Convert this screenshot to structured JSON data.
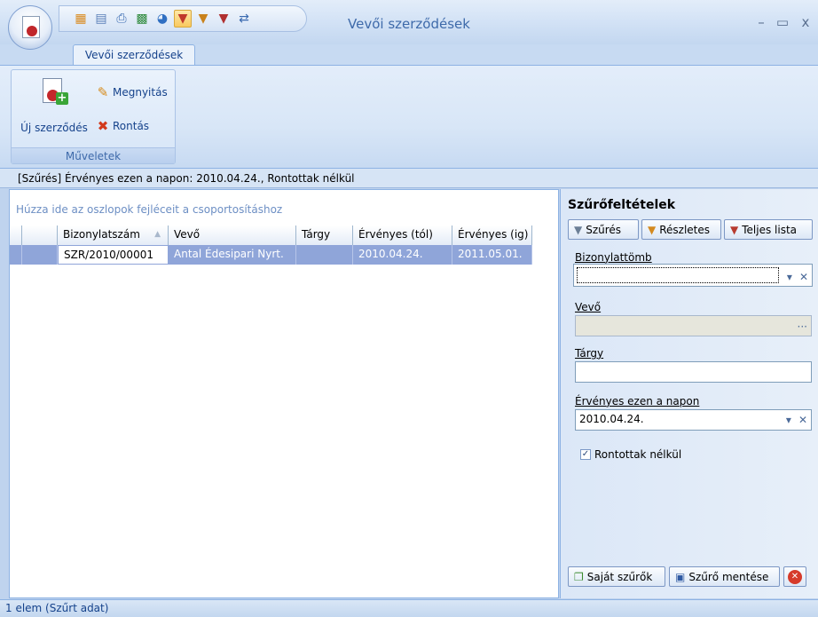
{
  "window": {
    "title": "Vevői szerződések",
    "controls": {
      "minimize": "–",
      "maximize": "▭",
      "close": "x"
    }
  },
  "quick_access": [
    {
      "name": "grid-icon",
      "glyph": "▦",
      "color": "#d98a1e"
    },
    {
      "name": "table-layout-icon",
      "glyph": "▤",
      "color": "#5a7fb8"
    },
    {
      "name": "print-icon",
      "glyph": "⎙",
      "color": "#3c6db3"
    },
    {
      "name": "excel-export-icon",
      "glyph": "▩",
      "color": "#2f8a3d"
    },
    {
      "name": "chart-icon",
      "glyph": "◕",
      "color": "#2f6fc2"
    },
    {
      "name": "filter-icon",
      "glyph": "▼",
      "color": "#c0392b",
      "active": true
    },
    {
      "name": "filter-detail-icon",
      "glyph": "▼",
      "color": "#c9821c"
    },
    {
      "name": "filter-remove-icon",
      "glyph": "▼",
      "color": "#b03030"
    },
    {
      "name": "export-icon",
      "glyph": "⇄",
      "color": "#3a6ab0"
    }
  ],
  "ribbon": {
    "tab_label": "Vevői szerződések",
    "group_label": "Műveletek",
    "new_contract_label": "Új szerződés",
    "open_label": "Megnyitás",
    "cancel_label": "Rontás"
  },
  "filter_summary": "[Szűrés]  Érvényes ezen a napon: 2010.04.24., Rontottak nélkül",
  "grid": {
    "group_hint": "Húzza ide az oszlopok fejléceit a csoportosításhoz",
    "columns": [
      "Bizonylatszám",
      "Vevő",
      "Tárgy",
      "Érvényes (tól)",
      "Érvényes (ig)"
    ],
    "rows": [
      {
        "number": "SZR/2010/00001",
        "customer": "Antal Édesipari Nyrt.",
        "subject": "",
        "valid_from": "2010.04.24.",
        "valid_to": "2011.05.01."
      }
    ]
  },
  "filter_panel": {
    "title": "Szűrőfeltételek",
    "tabs": {
      "filter": "Szűrés",
      "detailed": "Részletes",
      "full_list": "Teljes lista"
    },
    "fields": {
      "doc_block_label": "Bizonylattömb",
      "doc_block_value": "",
      "customer_label": "Vevő",
      "customer_value": "",
      "subject_label": "Tárgy",
      "subject_value": "",
      "valid_on_label": "Érvényes ezen a napon",
      "valid_on_value": "2010.04.24."
    },
    "exclude_cancelled_label": "Rontottak nélkül",
    "exclude_cancelled_checked": true,
    "own_filters_label": "Saját szűrők",
    "save_filter_label": "Szűrő mentése"
  },
  "status": "1 elem (Szűrt adat)"
}
